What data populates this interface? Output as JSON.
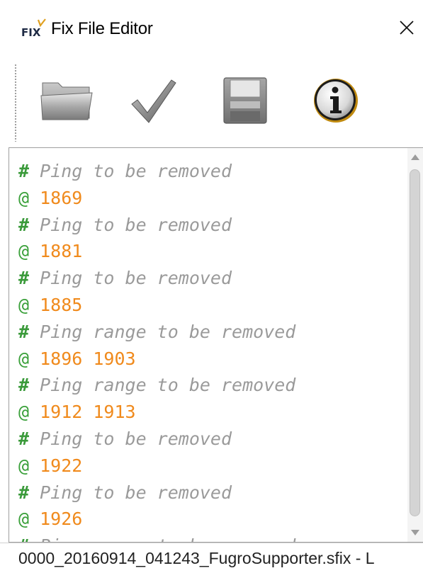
{
  "window": {
    "title": "Fix File Editor",
    "close_glyph": "✕"
  },
  "toolbar": {
    "buttons": [
      {
        "name": "open",
        "icon": "folder-icon"
      },
      {
        "name": "validate",
        "icon": "checkmark-icon"
      },
      {
        "name": "save",
        "icon": "floppy-disk-icon"
      },
      {
        "name": "info",
        "icon": "info-icon"
      }
    ]
  },
  "editor": {
    "lines": [
      {
        "type": "comment",
        "marker": "#",
        "text": " Ping to be removed"
      },
      {
        "type": "value",
        "marker": "@",
        "text": " 1869"
      },
      {
        "type": "comment",
        "marker": "#",
        "text": " Ping to be removed"
      },
      {
        "type": "value",
        "marker": "@",
        "text": " 1881"
      },
      {
        "type": "comment",
        "marker": "#",
        "text": " Ping to be removed"
      },
      {
        "type": "value",
        "marker": "@",
        "text": " 1885"
      },
      {
        "type": "comment",
        "marker": "#",
        "text": " Ping range to be removed"
      },
      {
        "type": "value",
        "marker": "@",
        "text": " 1896 1903"
      },
      {
        "type": "comment",
        "marker": "#",
        "text": " Ping range to be removed"
      },
      {
        "type": "value",
        "marker": "@",
        "text": " 1912 1913"
      },
      {
        "type": "comment",
        "marker": "#",
        "text": " Ping to be removed"
      },
      {
        "type": "value",
        "marker": "@",
        "text": " 1922"
      },
      {
        "type": "comment",
        "marker": "#",
        "text": " Ping to be removed"
      },
      {
        "type": "value",
        "marker": "@",
        "text": " 1926"
      },
      {
        "type": "comment",
        "marker": "#",
        "text": " Ping range to be removed"
      }
    ]
  },
  "status": {
    "text": "0000_20160914_041243_FugroSupporter.sfix - L"
  },
  "colors": {
    "comment_marker": "#3a9a3a",
    "comment_text": "#9a9a9a",
    "value_marker": "#3aa03a",
    "value_text": "#f08a1c"
  }
}
